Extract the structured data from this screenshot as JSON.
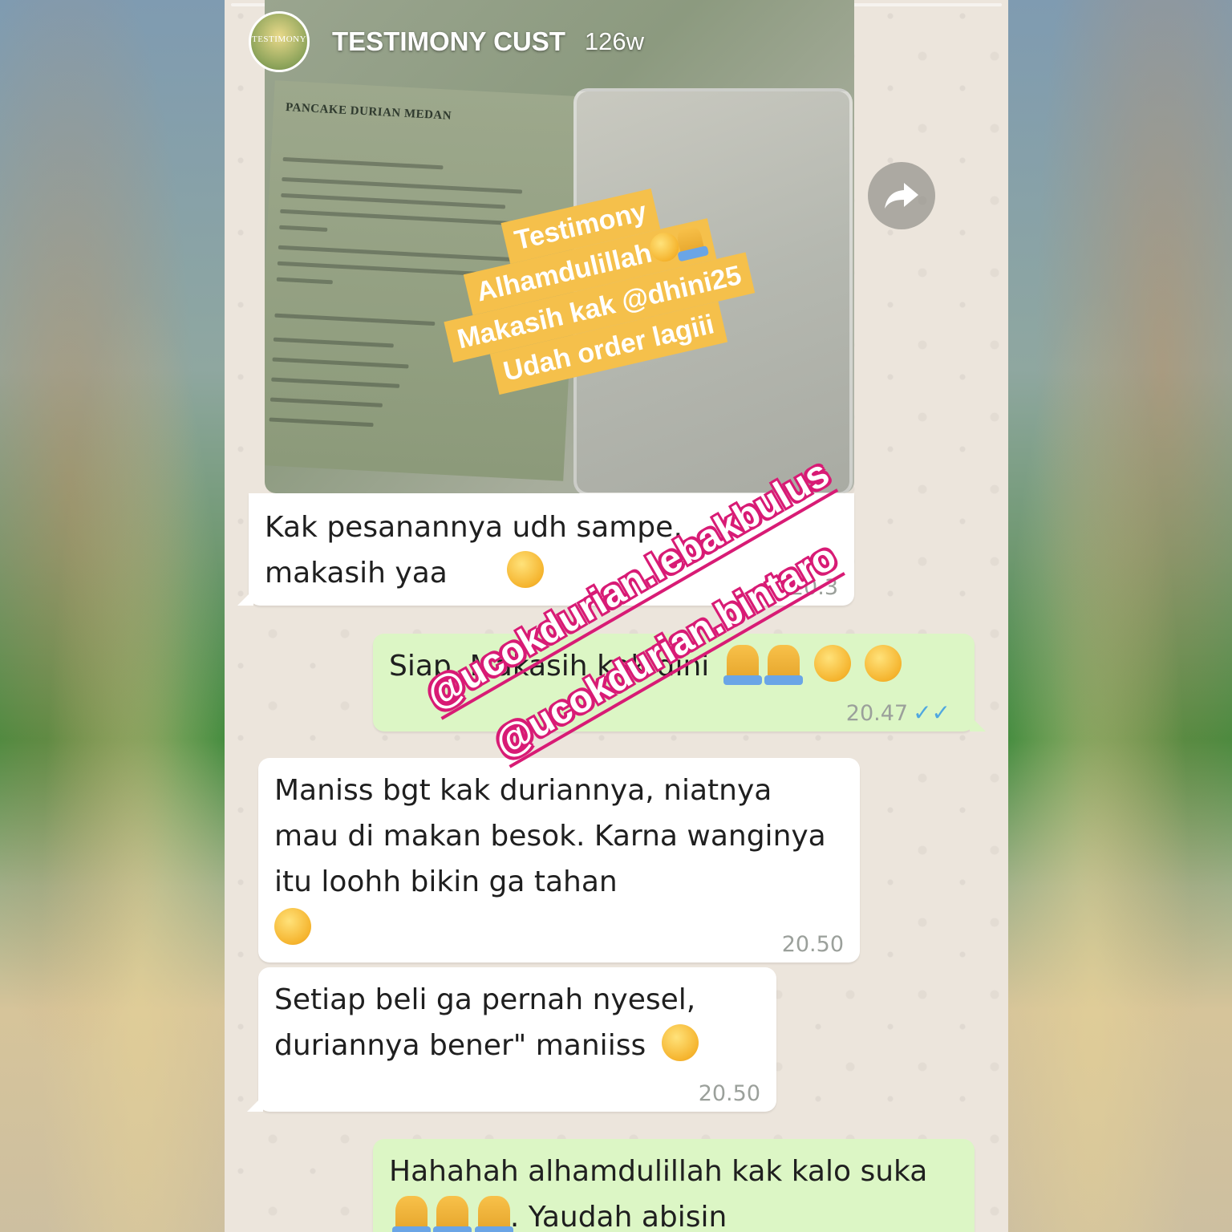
{
  "story": {
    "username": "TESTIMONY CUST",
    "time_ago": "126w",
    "avatar_text": "TESTIMONY"
  },
  "photo": {
    "label_title": "PANCAKE DURIAN MEDAN"
  },
  "sticker": {
    "lines": [
      "Testimony",
      "Alhamdulillah",
      "Makasih kak @dhini25",
      "Udah order lagiii"
    ]
  },
  "handles": [
    "@ucokdurian.lebakbulus",
    "@ucokdurian.bintaro"
  ],
  "messages": [
    {
      "text": "Kak pesanannya udh sampe,\nmakasih yaa",
      "time": "20.3"
    },
    {
      "text": "Siap. Makasih kak dini",
      "time": "20.47"
    },
    {
      "text": "Maniss bgt kak duriannya, niatnya mau di makan besok. Karna wanginya itu loohh bikin ga tahan",
      "time": "20.50"
    },
    {
      "text": "Setiap beli ga pernah nyesel, duriannya bener\" maniiss",
      "time": "20.50"
    },
    {
      "text": "Hahahah alhamdulillah kak kalo suka",
      "text_after": ". Yaudah abisin"
    }
  ],
  "icons": {
    "forward": "forward-arrow-icon",
    "read_receipt": "double-check-icon"
  },
  "colors": {
    "incoming_bubble": "#ffffff",
    "outgoing_bubble": "#dcf6c5",
    "sticker": "#f5c04b",
    "handle_outline": "#d81b75",
    "read_ticks": "#4fa7e0"
  }
}
